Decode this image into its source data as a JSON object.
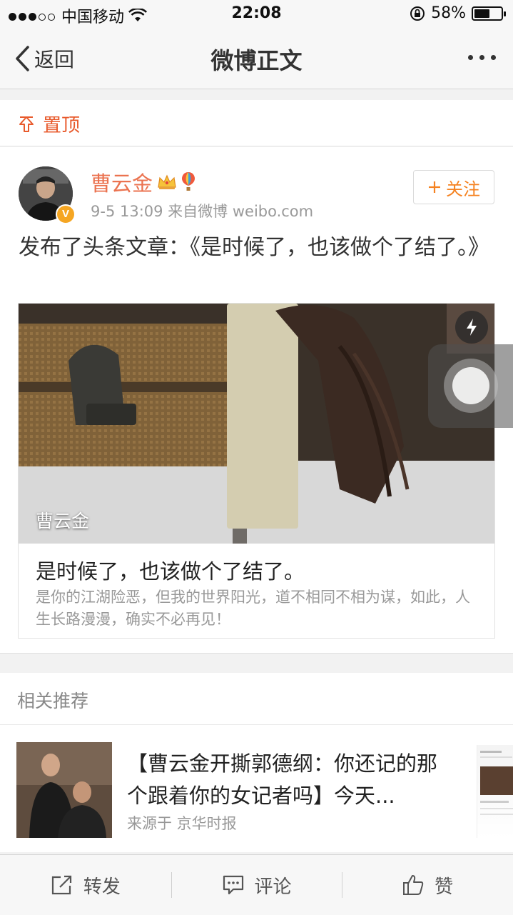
{
  "status_bar": {
    "carrier": "中国移动",
    "time": "22:08",
    "battery": "58%",
    "battery_level": 0.58
  },
  "nav": {
    "back_label": "返回",
    "title": "微博正文"
  },
  "pinned": {
    "label": "置顶"
  },
  "post": {
    "author": "曹云金",
    "verified_badge": "V",
    "meta": "9-5 13:09  来自微博 weibo.com",
    "follow_label": "关注",
    "text": "发布了头条文章：《是时候了，也该做个了结了。》",
    "article": {
      "cover_author": "曹云金",
      "title": "是时候了，也该做个了结了。",
      "description": "是你的江湖险恶，但我的世界阳光，道不相同不相为谋，如此，人生长路漫漫，确实不必再见！"
    }
  },
  "related": {
    "heading": "相关推荐",
    "item": {
      "title": "【曹云金开撕郭德纲：你还记的那个跟着你的女记者吗】今天...",
      "source": "来源于 京华时报"
    }
  },
  "toolbar": {
    "repost": "转发",
    "comment": "评论",
    "like": "赞"
  },
  "colors": {
    "accent_orange": "#eb7350",
    "follow_orange": "#f58220",
    "pin_red": "#e85a2c"
  }
}
